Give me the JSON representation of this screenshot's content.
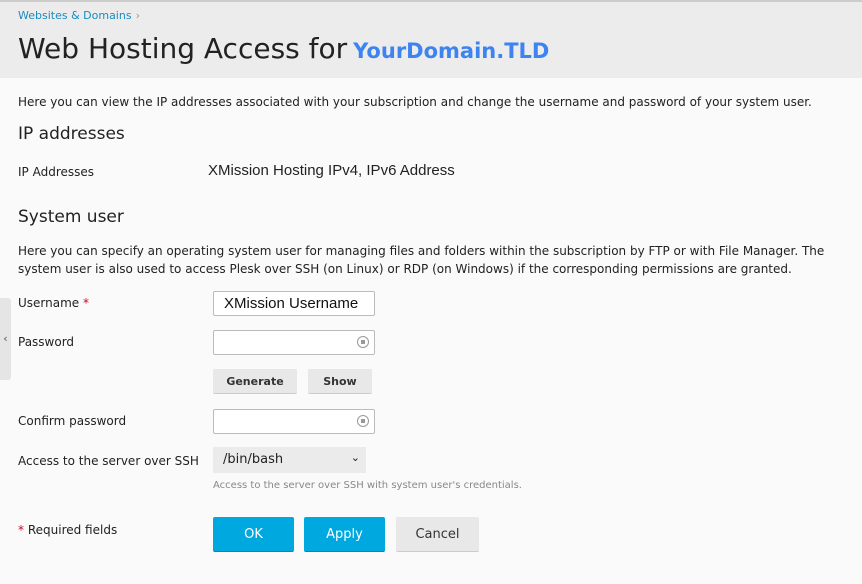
{
  "breadcrumb": {
    "item": "Websites & Domains",
    "sep": "›"
  },
  "title": {
    "text": "Web Hosting Access for",
    "domain": "YourDomain.TLD"
  },
  "intro": "Here you can view the IP addresses associated with your subscription and change the username and password of your system user.",
  "ip": {
    "heading": "IP addresses",
    "label": "IP Addresses",
    "value": "XMission Hosting IPv4, IPv6 Address"
  },
  "system_user": {
    "heading": "System user",
    "desc1": "Here you can specify an operating system user for managing files and folders within the subscription by FTP or with File Manager. The",
    "desc2": "system user is also used to access Plesk over SSH (on Linux) or RDP (on Windows) if the corresponding permissions are granted."
  },
  "form": {
    "username_label": "Username",
    "required_mark": "*",
    "username_value": "XMission Username",
    "password_label": "Password",
    "generate": "Generate",
    "show": "Show",
    "confirm_label": "Confirm password",
    "ssh_label": "Access to the server over SSH",
    "ssh_value": "/bin/bash",
    "ssh_hint": "Access to the server over SSH with system user's credentials.",
    "required_fields": "Required fields"
  },
  "buttons": {
    "ok": "OK",
    "apply": "Apply",
    "cancel": "Cancel"
  },
  "sidebar": {
    "toggle": "‹"
  }
}
